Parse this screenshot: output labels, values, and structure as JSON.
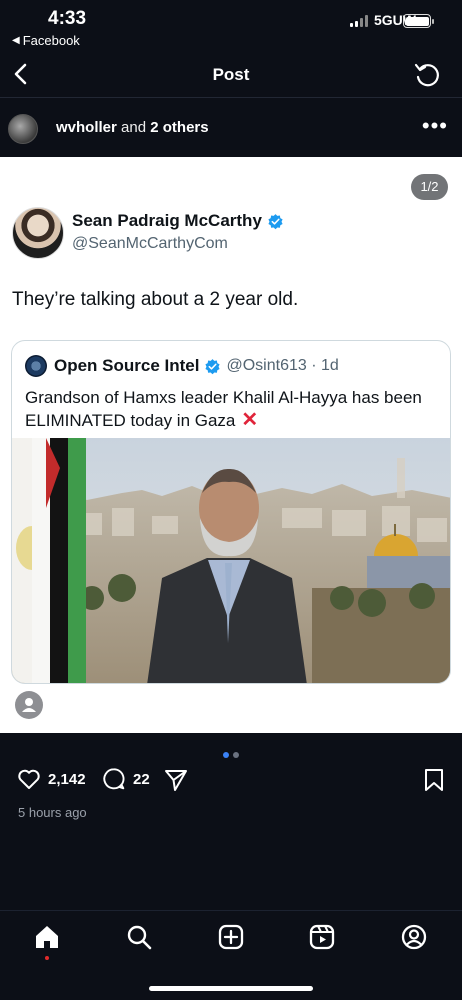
{
  "status_bar": {
    "time": "4:33",
    "back_app": "Facebook",
    "network": "5GUW"
  },
  "header": {
    "title": "Post"
  },
  "liked_by": {
    "first": "wvholler",
    "and": " and ",
    "others": "2 others"
  },
  "post": {
    "pager": "1/2",
    "author": {
      "name": "Sean Padraig McCarthy",
      "handle": "@SeanMcCarthyCom"
    },
    "text": "They’re talking about a 2 year old.",
    "quote": {
      "name": "Open Source Intel",
      "handle": "@Osint613 · 1d",
      "text": "Grandson of Hamxs leader Khalil Al-Hayya has been ELIMINATED today in Gaza",
      "emoji": "✕"
    }
  },
  "actions": {
    "likes": "2,142",
    "comments": "22"
  },
  "posted": "5 hours ago",
  "colors": {
    "background": "#0c0f17",
    "verified": "#1d9bf0",
    "notify_dot": "#e02b2b",
    "accent_dot": "#3b82f6"
  },
  "icons": [
    "chevron-left-icon",
    "refresh-icon",
    "more-icon",
    "verified-icon",
    "heart-icon",
    "comment-icon",
    "send-icon",
    "bookmark-icon",
    "home-icon",
    "search-icon",
    "create-icon",
    "reels-icon",
    "profile-icon"
  ]
}
